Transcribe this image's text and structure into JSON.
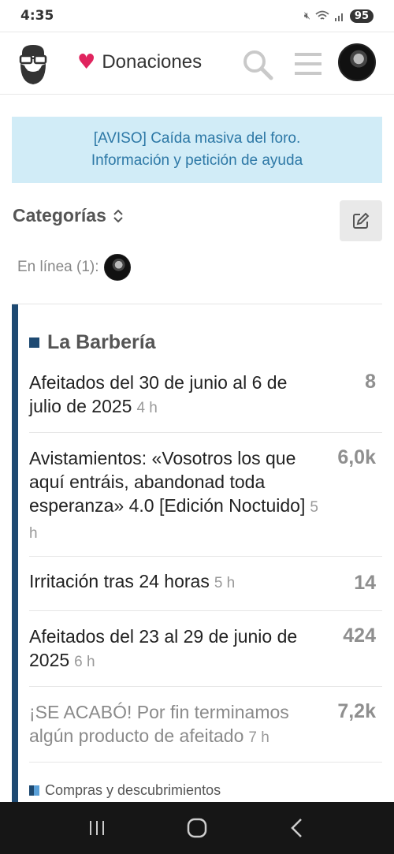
{
  "status": {
    "time": "4:35",
    "battery": "95"
  },
  "header": {
    "donate_label": "Donaciones"
  },
  "notice": {
    "line1": "[AVISO] Caída masiva del foro.",
    "line2": "Información y petición de ayuda"
  },
  "categories_toggle": {
    "label": "Categorías"
  },
  "online": {
    "label": "En línea (1):"
  },
  "category": {
    "name": "La Barbería",
    "color": "#1e4a72",
    "topics": [
      {
        "title": "Afeitados del 30 de junio al 6 de julio de 2025",
        "time": "4 h",
        "count": "8"
      },
      {
        "title": "Avistamientos: «Vosotros los que aquí entráis, abandonad toda esperanza» 4.0 [Edición Noctuido]",
        "time": "5 h",
        "count": "6,0k"
      },
      {
        "title": "Irritación tras 24 horas",
        "time": "5 h",
        "count": "14"
      },
      {
        "title": "Afeitados del 23 al 29 de junio de 2025",
        "time": "6 h",
        "count": "424"
      },
      {
        "title": "¡SE ACABÓ! Por fin terminamos algún producto de afeitado",
        "time": "7 h",
        "count": "7,2k"
      }
    ],
    "subcategory": "Compras y descubrimientos"
  }
}
